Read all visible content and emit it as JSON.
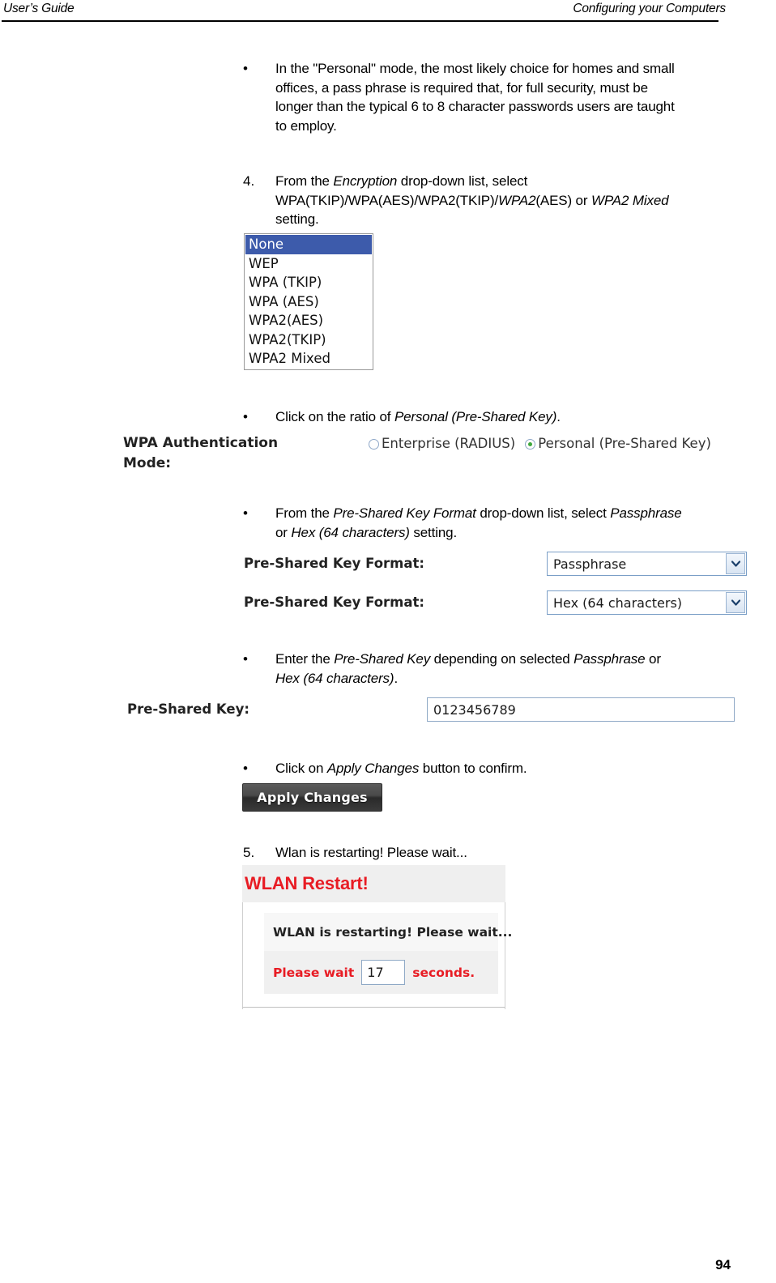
{
  "header": {
    "left": "User’s Guide",
    "right": "Configuring your Computers"
  },
  "body": {
    "bullet_personal_mode": "In the \"Personal\" mode, the most likely choice for homes and small offices, a pass phrase is required that, for full security, must be longer than the typical 6 to 8 character passwords users are taught to employ.",
    "step4_marker": "4.",
    "step4_text_part1": "From the ",
    "step4_encryption_italic": "Encryption",
    "step4_text_part2": " drop-down list, select WPA(TKIP)/WPA(AES)/WPA2(TKIP)/",
    "step4_wpa2_italic": "WPA2",
    "step4_text_part3": "(AES) or ",
    "step4_wpa2mixed_italic": "WPA2 Mixed",
    "step4_text_part4": " setting.",
    "bullet_ratio_part1": "Click on the ratio of ",
    "bullet_ratio_italic": "Personal (Pre-Shared Key)",
    "bullet_ratio_part2": ".",
    "bullet_pskformat_part1": "From the ",
    "bullet_pskformat_italic1": "Pre-Shared Key Format",
    "bullet_pskformat_part2": " drop-down list, select ",
    "bullet_pskformat_italic2": "Passphrase",
    "bullet_pskformat_part3": " or ",
    "bullet_pskformat_italic3": "Hex (64 characters)",
    "bullet_pskformat_part4": " setting.",
    "bullet_enterpsk_part1": "Enter the ",
    "bullet_enterpsk_italic1": "Pre-Shared Key",
    "bullet_enterpsk_part2": " depending on selected ",
    "bullet_enterpsk_italic2": "Passphrase",
    "bullet_enterpsk_part3": " or ",
    "bullet_enterpsk_italic3": "Hex (64 characters)",
    "bullet_enterpsk_part4": ".",
    "bullet_apply_part1": "Click on ",
    "bullet_apply_italic": "Apply Changes",
    "bullet_apply_part2": " button to confirm.",
    "step5_marker": "5.",
    "step5_text": "Wlan is restarting! Please wait...",
    "bullet_marker": "•"
  },
  "encryption_dropdown": {
    "name": "Encryption",
    "selected": "None",
    "options": [
      "None",
      "WEP",
      "WPA (TKIP)",
      "WPA (AES)",
      "WPA2(AES)",
      "WPA2(TKIP)",
      "WPA2 Mixed"
    ],
    "highlight_color": "#3d5bab"
  },
  "wpa_auth_mode": {
    "label": "WPA Authentication Mode:",
    "options": [
      {
        "label": "Enterprise (RADIUS)",
        "checked": false
      },
      {
        "label": "Personal (Pre-Shared Key)",
        "checked": true
      }
    ],
    "selected_dot_color": "#3da83d"
  },
  "psk_format_rows": [
    {
      "label": "Pre-Shared Key Format:",
      "value": "Passphrase"
    },
    {
      "label": "Pre-Shared Key Format:",
      "value": "Hex (64 characters)"
    }
  ],
  "psk_field": {
    "label": "Pre-Shared Key:",
    "value": "0123456789"
  },
  "apply_button": {
    "label": "Apply Changes"
  },
  "wlan_restart": {
    "title": "WLAN Restart!",
    "title_color": "#e81c24",
    "message": "WLAN is restarting! Please wait...",
    "wait_prefix": "Please wait",
    "seconds_value": "17",
    "wait_suffix": "seconds."
  },
  "footer": {
    "page_number": "94"
  }
}
